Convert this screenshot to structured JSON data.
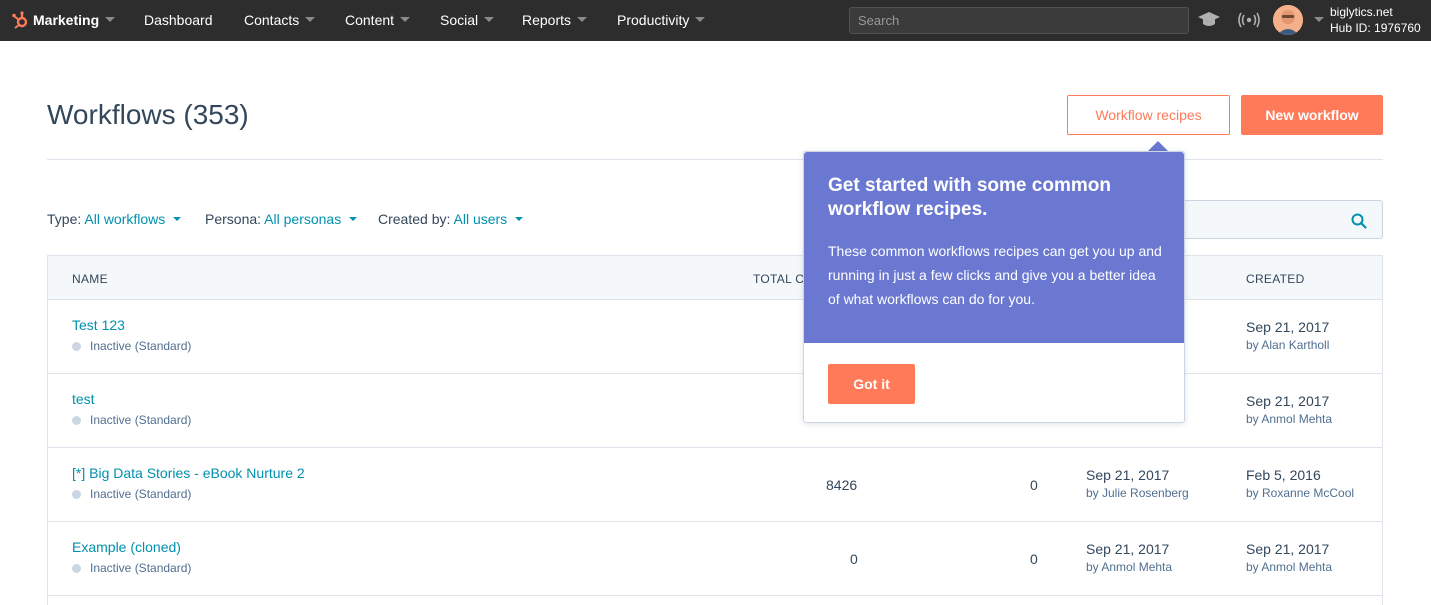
{
  "topnav": {
    "brand": "Marketing",
    "items": [
      "Dashboard",
      "Contacts",
      "Content",
      "Social",
      "Reports",
      "Productivity"
    ],
    "search_placeholder": "Search",
    "account_domain": "biglytics.net",
    "hub_id": "Hub ID: 1976760",
    "icons": [
      "sprocket-logo-icon",
      "academy-icon",
      "notifications-icon",
      "avatar"
    ]
  },
  "page": {
    "title": "Workflows (353)",
    "recipes_button": "Workflow recipes",
    "new_button": "New workflow"
  },
  "filters": [
    {
      "label": "Type:",
      "value": "All workflows"
    },
    {
      "label": "Persona:",
      "value": "All personas"
    },
    {
      "label": "Created by:",
      "value": "All users"
    }
  ],
  "table": {
    "headers": {
      "name": "NAME",
      "total": "TOTAL C",
      "created": "CREATED"
    },
    "rows": [
      {
        "name": "Test 123",
        "status": "Inactive (Standard)",
        "total": "",
        "active": "",
        "updated_date": "",
        "updated_by": "",
        "created_date": "Sep 21, 2017",
        "created_by": "by Alan Kartholl"
      },
      {
        "name": "test",
        "status": "Inactive (Standard)",
        "total": "",
        "active": "",
        "updated_date": "",
        "updated_by": "",
        "created_date": "Sep 21, 2017",
        "created_by": "by Anmol Mehta"
      },
      {
        "name": "[*] Big Data Stories - eBook Nurture 2",
        "status": "Inactive (Standard)",
        "total": "8426",
        "active": "0",
        "updated_date": "Sep 21, 2017",
        "updated_by": "by Julie Rosenberg",
        "created_date": "Feb 5, 2016",
        "created_by": "by Roxanne McCool"
      },
      {
        "name": "Example (cloned)",
        "status": "Inactive (Standard)",
        "total": "0",
        "active": "0",
        "updated_date": "Sep 21, 2017",
        "updated_by": "by Anmol Mehta",
        "created_date": "Sep 21, 2017",
        "created_by": "by Anmol Mehta"
      }
    ]
  },
  "popover": {
    "title": "Get started with some common workflow recipes.",
    "body": "These common workflows recipes can get you up and running in just a few clicks and give you a better idea of what workflows can do for you.",
    "button": "Got it"
  },
  "colors": {
    "accent": "#ff7a59",
    "link": "#0091ae",
    "popover": "#6a78d1",
    "nav": "#2d2d2d"
  }
}
